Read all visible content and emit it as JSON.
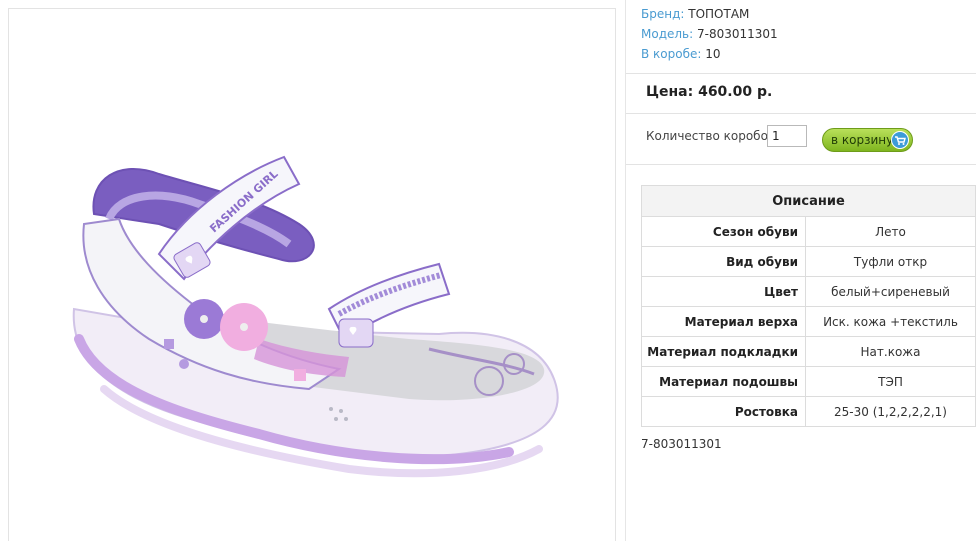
{
  "product": {
    "brand_label": "Бренд:",
    "brand": "ТОПОТАМ",
    "model_label": "Модель:",
    "model": "7-803011301",
    "box_label": "В коробе:",
    "box_count": "10",
    "price": "Цена: 460.00 р.",
    "quantity_label": "Количество коробов:",
    "quantity_value": "1",
    "cart_button": "в корзину",
    "sku_footer": "7-803011301"
  },
  "image": {
    "strap_text": "FASHION GIRL",
    "alt": "sandal"
  },
  "description": {
    "title": "Описание",
    "rows": [
      {
        "key": "Сезон обуви",
        "value": "Лето"
      },
      {
        "key": "Вид обуви",
        "value": "Туфли откр"
      },
      {
        "key": "Цвет",
        "value": "белый+сиреневый"
      },
      {
        "key": "Материал верха",
        "value": "Иск. кожа +текстиль"
      },
      {
        "key": "Материал подкладки",
        "value": "Нат.кожа"
      },
      {
        "key": "Материал подошвы",
        "value": "ТЭП"
      },
      {
        "key": "Ростовка",
        "value": "25-30 (1,2,2,2,2,1)"
      }
    ]
  },
  "colors": {
    "link_blue": "#4a9bd1",
    "button_green": "#8fc43a",
    "sandal_purple": "#8a6dc9",
    "sandal_white": "#f4f4f8"
  }
}
